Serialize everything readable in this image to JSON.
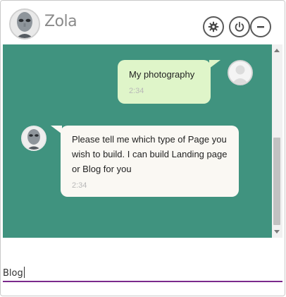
{
  "header": {
    "title": "Zola",
    "settings_icon": "gear-icon",
    "power_icon": "power-icon",
    "minimize_icon": "minus-icon"
  },
  "messages": [
    {
      "sender": "user",
      "text": "My photography",
      "time": "2:34"
    },
    {
      "sender": "bot",
      "text": "Please tell me which type of Page you wish to build. I can build Landing page or Blog for you",
      "time": "2:34"
    }
  ],
  "input": {
    "value": "Blog"
  },
  "colors": {
    "chat_bg": "#40937f",
    "user_bubble": "#dff5c9",
    "bot_bubble": "#faf8f3",
    "input_underline": "#7b2a8c"
  }
}
